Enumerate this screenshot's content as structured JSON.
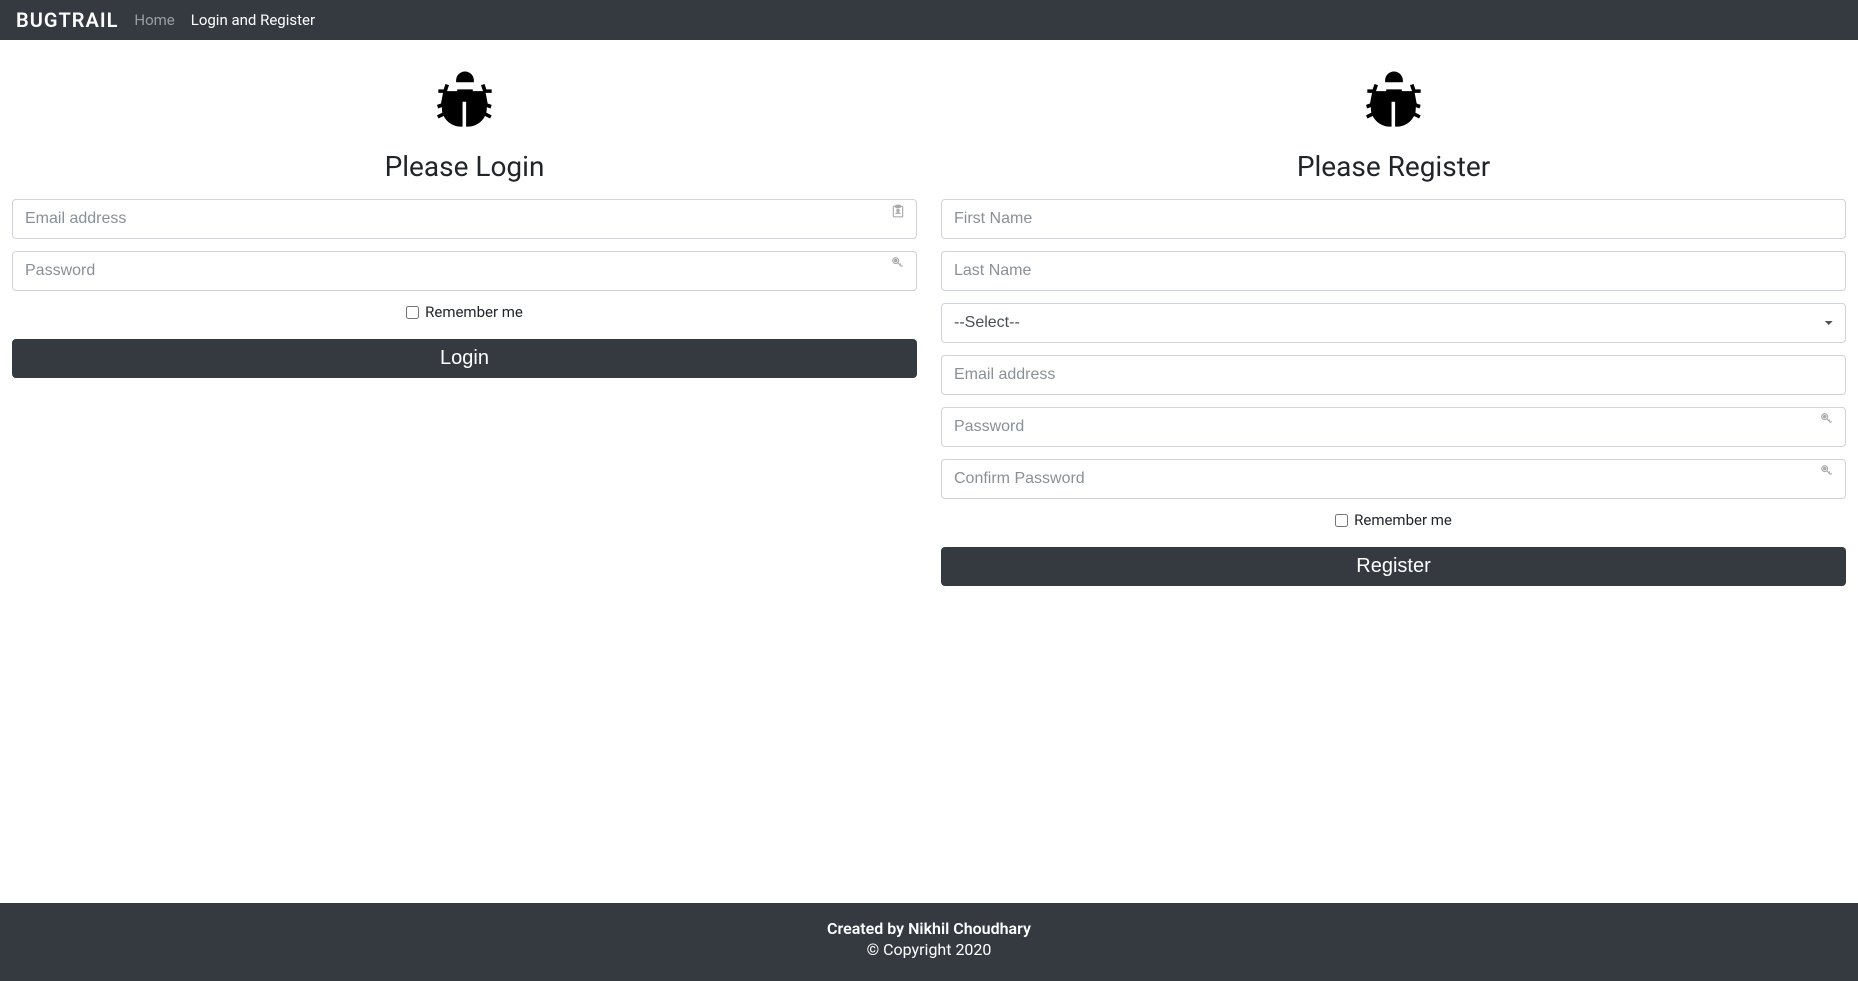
{
  "nav": {
    "brand": "BUGTRAIL",
    "links": [
      {
        "label": "Home"
      },
      {
        "label": "Login and Register"
      }
    ]
  },
  "login": {
    "title": "Please Login",
    "email_placeholder": "Email address",
    "password_placeholder": "Password",
    "remember_label": "Remember me",
    "button_label": "Login"
  },
  "register": {
    "title": "Please Register",
    "firstname_placeholder": "First Name",
    "lastname_placeholder": "Last Name",
    "select_default": "--Select--",
    "email_placeholder": "Email address",
    "password_placeholder": "Password",
    "confirm_placeholder": "Confirm Password",
    "remember_label": "Remember me",
    "button_label": "Register"
  },
  "footer": {
    "creator": "Created by Nikhil Choudhary",
    "copyright": "© Copyright 2020"
  }
}
